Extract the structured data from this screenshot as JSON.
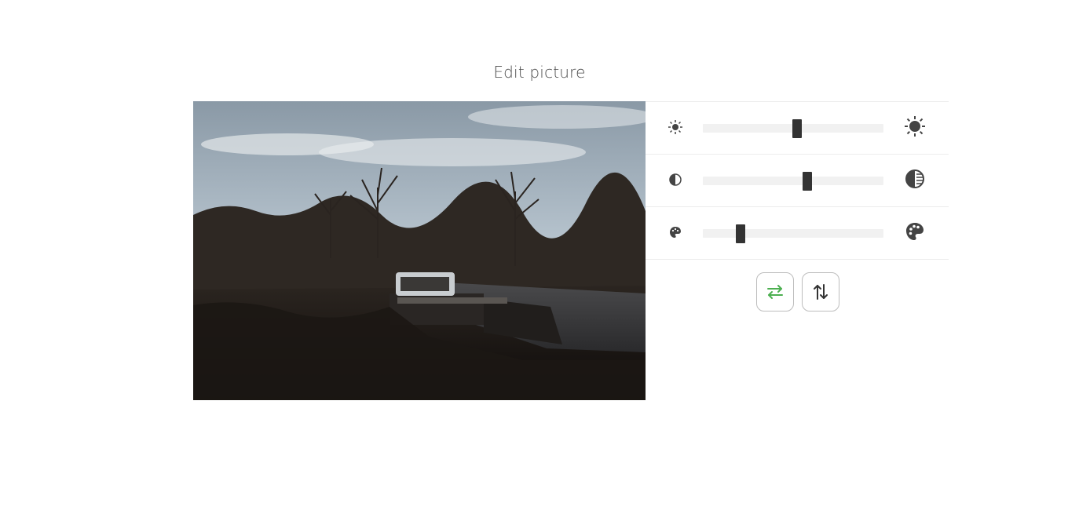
{
  "page": {
    "title": "Edit picture"
  },
  "photo": {
    "description_icon": "canal-boat-photo"
  },
  "adjustments": [
    {
      "name": "brightness",
      "icon_low": "sun-small-icon",
      "icon_high": "sun-large-icon",
      "value_fraction": 0.52
    },
    {
      "name": "contrast",
      "icon_low": "contrast-small-icon",
      "icon_high": "contrast-large-icon",
      "value_fraction": 0.58
    },
    {
      "name": "saturation",
      "icon_low": "palette-small-icon",
      "icon_high": "palette-large-icon",
      "value_fraction": 0.21
    }
  ],
  "buttons": {
    "flip_horizontal": {
      "icon": "flip-horizontal-icon",
      "color": "#4caf50"
    },
    "flip_vertical": {
      "icon": "flip-vertical-icon",
      "color": "#333333"
    }
  },
  "colors": {
    "slider_thumb": "#333333",
    "slider_track": "#f1f1f1",
    "accent": "#4caf50"
  }
}
